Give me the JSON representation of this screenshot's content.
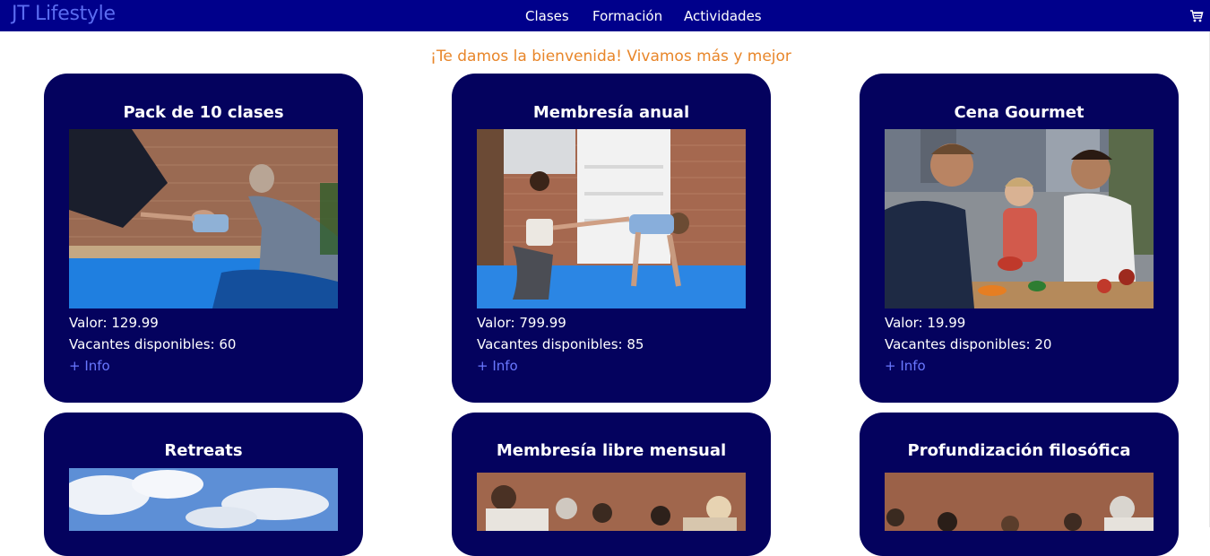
{
  "navbar": {
    "brand": "JT Lifestyle",
    "links": [
      "Clases",
      "Formación",
      "Actividades"
    ],
    "cart_icon": "cart-icon",
    "background": "#00008b"
  },
  "welcome": "¡Te damos la bienvenida! Vivamos más y mejor",
  "colors": {
    "accent": "#e8862a",
    "card_bg": "#04025e",
    "link": "#6a78ff"
  },
  "cards": [
    {
      "title": "Pack de 10 clases",
      "price": "Valor: 129.99",
      "vacancies": "Vacantes disponibles: 60",
      "info": "+ Info"
    },
    {
      "title": "Membresía anual",
      "price": "Valor: 799.99",
      "vacancies": "Vacantes disponibles: 85",
      "info": "+ Info"
    },
    {
      "title": "Cena Gourmet",
      "price": "Valor: 19.99",
      "vacancies": "Vacantes disponibles: 20",
      "info": "+ Info"
    },
    {
      "title": "Retreats"
    },
    {
      "title": "Membresía libre mensual"
    },
    {
      "title": "Profundización filosófica"
    }
  ]
}
